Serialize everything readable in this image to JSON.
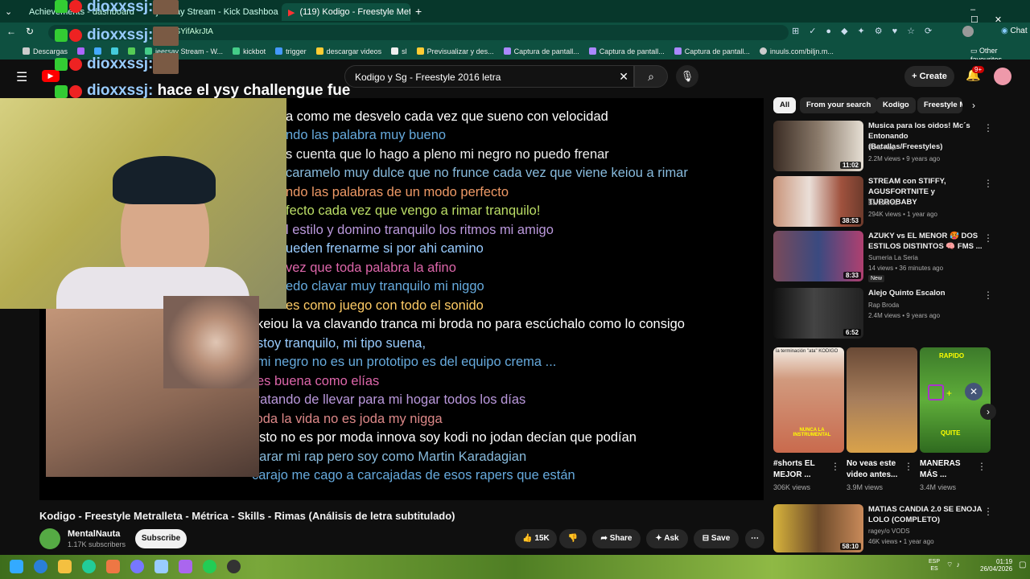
{
  "browser": {
    "tabs": [
      {
        "label": "Achievements - dashboard",
        "active": false
      },
      {
        "label": "jeersay Stream - Kick Dashboard",
        "active": false
      },
      {
        "label": "(119) Kodigo - Freestyle Metra",
        "active": true
      }
    ],
    "url": "9SYifAkrJtA",
    "bookmarks": [
      "Descargas",
      "jeersay Stream - W...",
      "kickbot",
      "trigger",
      "descargar videos",
      "sl",
      "Previsualizar y des...",
      "Captura de pantall...",
      "Captura de pantall...",
      "Captura de pantall...",
      "inuuls.com/biljn.m..."
    ],
    "other_favorites": "Other favourites",
    "copilot_label": "Chat"
  },
  "youtube": {
    "search_value": "Kodigo y Sg - Freestyle 2016 letra",
    "create_label": "Create",
    "notifications": "9+",
    "video_title": "Kodigo - Freestyle Metralleta - Métrica - Skills - Rimas (Análisis de letra subtitulado)",
    "channel_name": "MentalNauta",
    "subscribers": "1.17K subscribers",
    "subscribe_label": "Subscribe",
    "likes": "15K",
    "share_label": "Share",
    "ask_label": "Ask",
    "save_label": "Save"
  },
  "chat_overlay": [
    {
      "user": "dioxxssj:",
      "message": ""
    },
    {
      "user": "dioxxssj:",
      "message": ""
    },
    {
      "user": "dioxxssj:",
      "message": ""
    },
    {
      "user": "dioxxssj:",
      "message": "hace el ysy challengue fue"
    }
  ],
  "lyrics": [
    "a como me desvelo cada vez que sueno con velocidad",
    "ndo las palabra muy bueno",
    "s cuenta que lo hago a pleno mi negro no puedo frenar",
    "caramelo muy dulce que no frunce cada vez que viene keiou a rimar",
    "ndo las palabras de un modo perfecto",
    "fecto cada vez que vengo a rimar tranquilo!",
    "l estilo y domino tranquilo los ritmos mi amigo",
    "ueden frenarme si por ahi camino",
    "vez que toda palabra la afino",
    "edo clavar muy tranquilo mi niggo",
    "es como juego con todo el sonido",
    "keiou la va clavando tranca mi broda no para escúchalo como lo consigo",
    "stoy tranquilo, mi tipo suena,",
    "mi negro no es un prototipo es del equipo crema ...",
    "es buena como elías",
    "tratando de llevar para mi hogar todos los días",
    "toda la vida no es joda my nigga",
    "esto no es por moda innova soy kodi no jodan decían que podían",
    "parar mi rap pero soy como Martin Karadagian",
    "carajo me cago a carcajadas de esos rapers que están"
  ],
  "chips": [
    "All",
    "From your search",
    "Kodigo",
    "Freestyle M"
  ],
  "recommended": [
    {
      "title": "Musica para los oidos! Mc´s Entonando (Batallas/Freestyles)",
      "channel": "Time Rap",
      "meta": "2.2M views • 9 years ago",
      "duration": "11:02",
      "color": "#5b4a3a"
    },
    {
      "title": "STREAM con STIFFY, AGUSFORTNITE y TURROBABY",
      "channel": "Bananirou",
      "meta": "294K views • 1 year ago",
      "duration": "38:53",
      "color": "#a66b5a"
    },
    {
      "title": "AZUKY vs EL MENOR 🥵 DOS ESTILOS DISTINTOS 🧠 FMS ...",
      "channel": "Sumeria La Seria",
      "meta": "14 views • 36 minutes ago",
      "duration": "8:33",
      "color": "#5b4a70",
      "badge": "New"
    },
    {
      "title": "Alejo Quinto Escalon",
      "channel": "Rap Broda",
      "meta": "2.4M views • 9 years ago",
      "duration": "6:52",
      "color": "#2b2b2b"
    },
    {
      "title": "MATIAS CANDIA 2.0 SE ENOJA LOLO (COMPLETO)",
      "channel": "ragey/o VODS",
      "meta": "46K views • 1 year ago",
      "duration": "58:10",
      "color": "#c9a23c"
    }
  ],
  "shorts": [
    {
      "title": "#shorts EL MEJOR ...",
      "views": "306K views",
      "color": "#c96a4d",
      "caption": "NUNCA LA INSTRUMENTAL",
      "top": "la terminación \"ata\" KODIGO"
    },
    {
      "title": "No veas este video antes...",
      "views": "3.9M views",
      "color": "#8a5a3a",
      "caption": "",
      "top": ""
    },
    {
      "title": "MANERAS MÁS ...",
      "views": "3.4M views",
      "color": "#3f8a2a",
      "caption": "QUITE",
      "top": "RAPIDO"
    }
  ],
  "taskbar": {
    "lang": "ESP",
    "lang2": "ES",
    "time": "01:19",
    "date": "26/04/2026"
  }
}
